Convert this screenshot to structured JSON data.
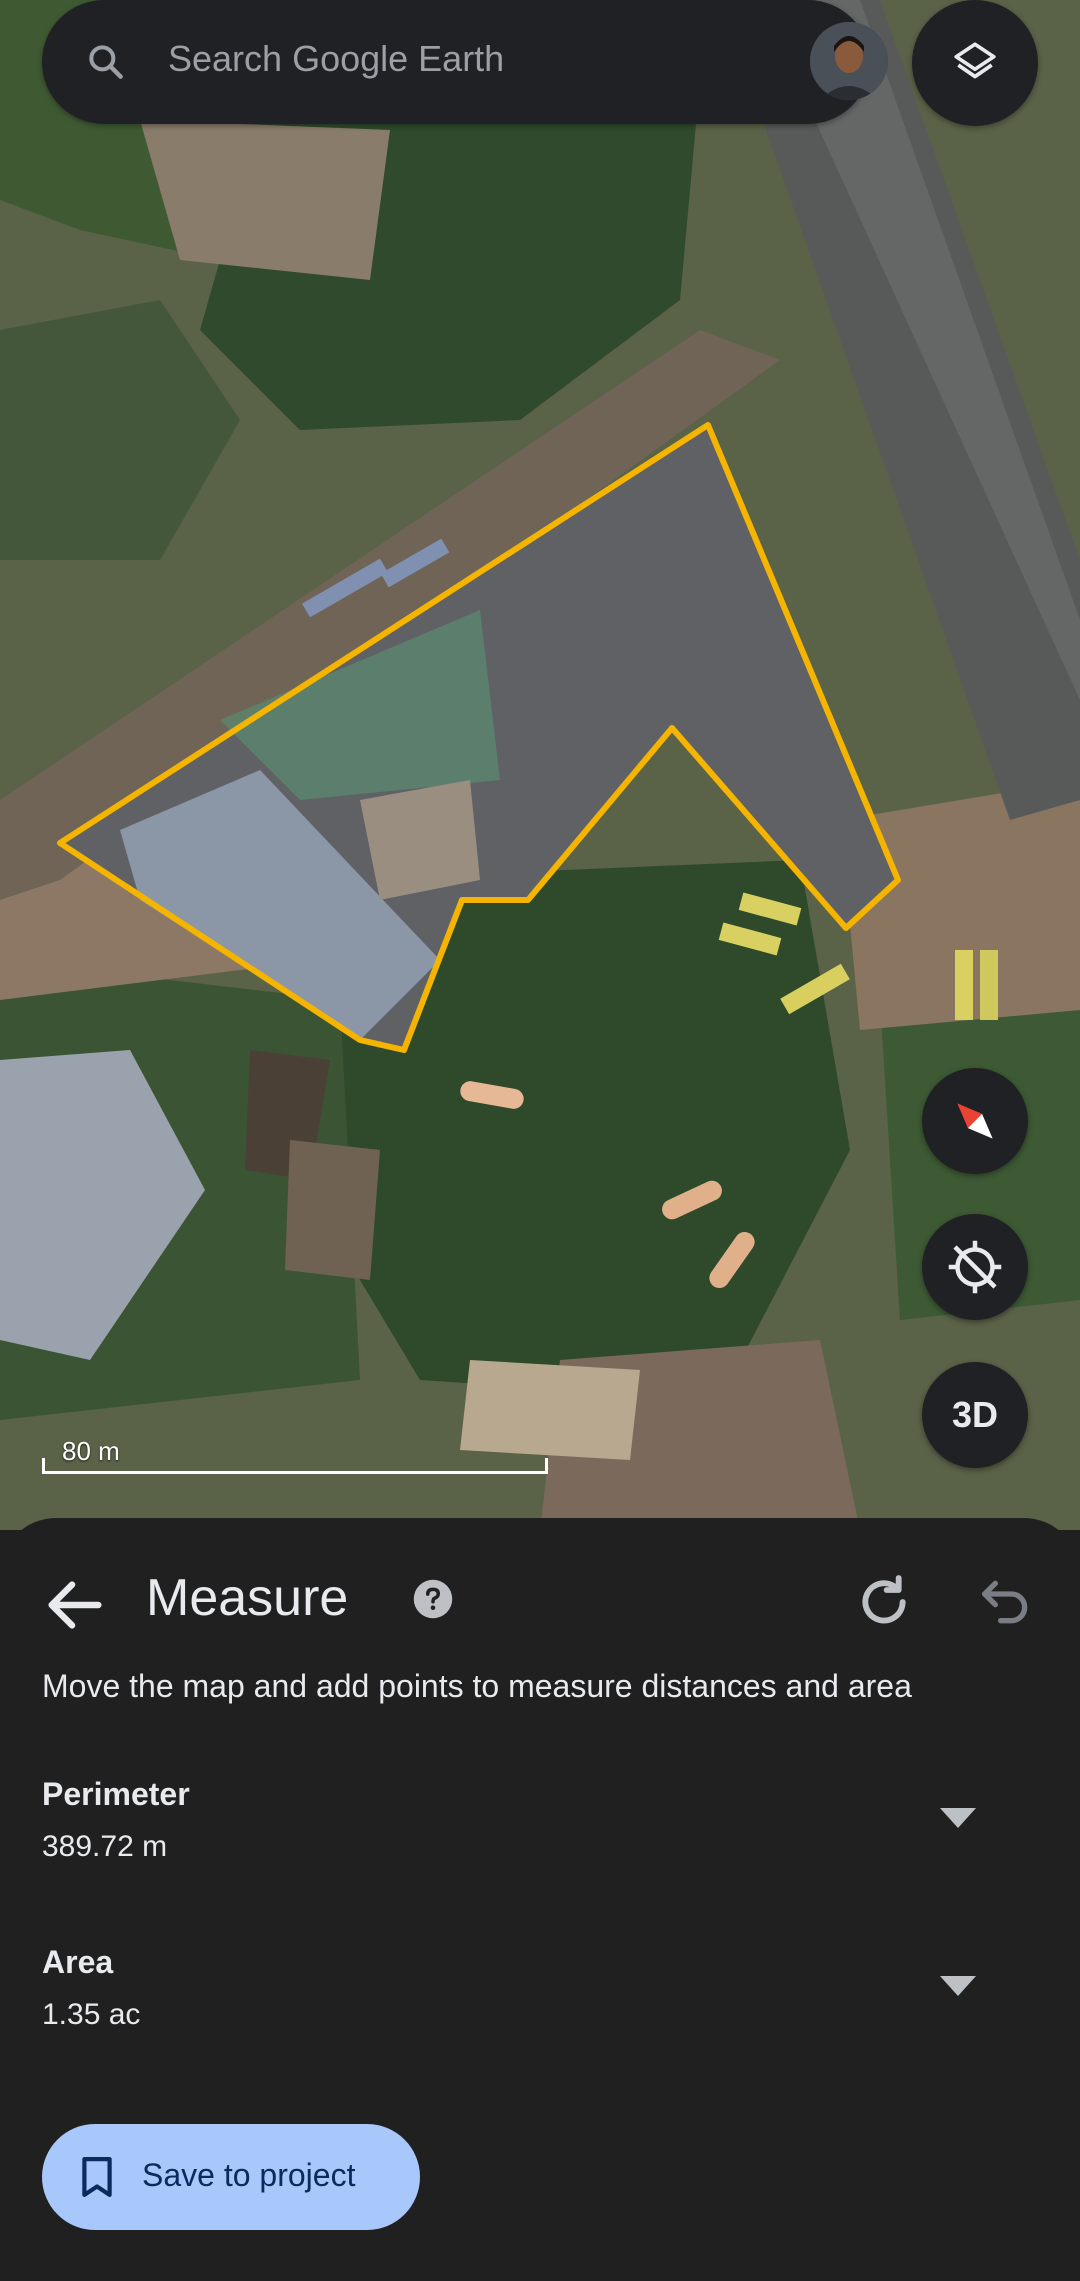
{
  "search": {
    "placeholder": "Search Google Earth"
  },
  "map": {
    "scale_label": "80 m",
    "three_d_label": "3D",
    "outline_color": "#f4b400"
  },
  "measure_panel": {
    "title": "Measure",
    "instructions": "Move the map and add points to measure distances and area",
    "perimeter": {
      "label": "Perimeter",
      "value": "389.72 m"
    },
    "area": {
      "label": "Area",
      "value": "1.35 ac"
    },
    "save_label": "Save to project"
  },
  "colors": {
    "sheet_background": "#202020",
    "save_button": "#a8c7fa",
    "compass_red": "#ea4335"
  }
}
